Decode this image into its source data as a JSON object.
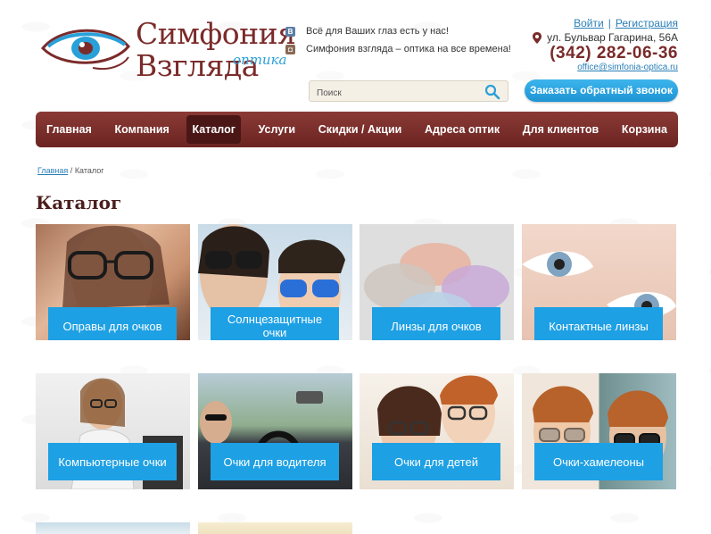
{
  "brand": {
    "line1": "Симфония",
    "line2": "Взгляда",
    "sub": "оптика",
    "color": "#7a2b2a",
    "accent": "#2aa0d8"
  },
  "social": [
    {
      "icon": "vk-icon",
      "text": "Всё для Ваших глаз есть у нас!"
    },
    {
      "icon": "instagram-icon",
      "text": "Симфония взгляда – оптика на все времена!"
    }
  ],
  "auth": {
    "login": "Войти",
    "separator": "|",
    "register": "Регистрация"
  },
  "contacts": {
    "address": "ул. Бульвар Гагарина, 56А",
    "phone": "(342) 282-06-36",
    "email": "office@simfonia-optica.ru"
  },
  "search": {
    "placeholder": "Поиск",
    "icon": "search-icon"
  },
  "callback_label": "Заказать обратный звонок",
  "nav": [
    {
      "label": "Главная",
      "active": false
    },
    {
      "label": "Компания",
      "active": false
    },
    {
      "label": "Каталог",
      "active": true
    },
    {
      "label": "Услуги",
      "active": false
    },
    {
      "label": "Скидки / Акции",
      "active": false
    },
    {
      "label": "Адреса оптик",
      "active": false
    },
    {
      "label": "Для клиентов",
      "active": false
    },
    {
      "label": "Корзина",
      "active": false
    }
  ],
  "breadcrumb": {
    "home": "Главная",
    "separator": "/",
    "current": "Каталог"
  },
  "page_title": "Каталог",
  "catalog": [
    {
      "label": "Оправы для очков"
    },
    {
      "label": "Солнцезащитные очки"
    },
    {
      "label": "Линзы для очков"
    },
    {
      "label": "Контактные линзы"
    },
    {
      "label": "Компьютерные очки"
    },
    {
      "label": "Очки для водителя"
    },
    {
      "label": "Очки для детей"
    },
    {
      "label": "Очки-хамелеоны"
    }
  ],
  "colors": {
    "nav_bg": "#7a2b2a",
    "nav_active": "#4a1716",
    "button_blue": "#1ea0e4",
    "link": "#2a7fb8"
  }
}
